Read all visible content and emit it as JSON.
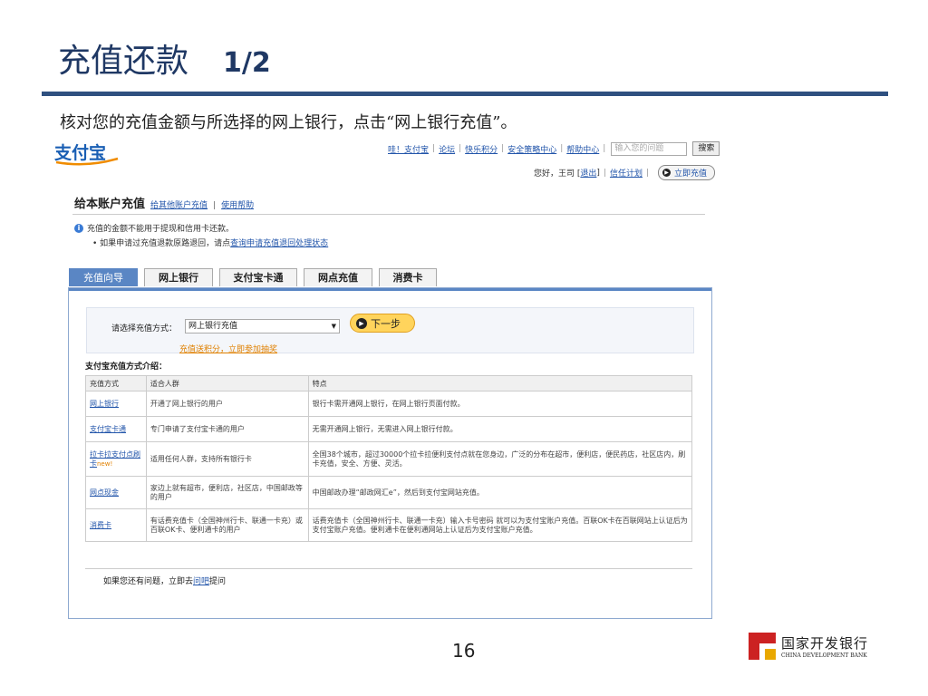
{
  "slide": {
    "title": "充值还款",
    "title_num": "1/2",
    "instruction": "核对您的充值金额与所选择的网上银行，点击“网上银行充值”。",
    "page_number": "16"
  },
  "alipay": {
    "logo_text": "支付宝",
    "top_links": [
      "哇！支付宝",
      "论坛",
      "快乐积分",
      "安全策略中心",
      "帮助中心"
    ],
    "search_placeholder": "输入您的问题",
    "search_button": "搜索",
    "greeting": "您好，王司 [",
    "logout": "退出",
    "greeting_end": "]",
    "trust_plan": "信任计划",
    "open_now": "立即充值"
  },
  "account": {
    "heading": "给本账户充值",
    "link_other": "给其他账户充值",
    "link_help": "使用帮助",
    "notice1": "充值的金额不能用于提现和信用卡还款。",
    "notice2_prefix": "• 如果申请过充值退款原路退回，请点",
    "notice2_link": "查询申请充值退回处理状态"
  },
  "tabs": [
    {
      "label": "充值向导",
      "active": true
    },
    {
      "label": "网上银行",
      "active": false
    },
    {
      "label": "支付宝卡通",
      "active": false
    },
    {
      "label": "网点充值",
      "active": false
    },
    {
      "label": "消费卡",
      "active": false
    }
  ],
  "form": {
    "select_label": "请选择充值方式：",
    "select_value": "网上银行充值",
    "next_button": "下一步",
    "promo_link": "充值送积分，立即参加抽奖"
  },
  "intro": {
    "title": "支付宝充值方式介绍：",
    "headers": [
      "充值方式",
      "适合人群",
      "特点"
    ],
    "rows": [
      {
        "method": "网上银行",
        "audience": "开通了网上银行的用户",
        "feature": "银行卡需开通网上银行，在网上银行页面付款。"
      },
      {
        "method": "支付宝卡通",
        "audience": "专门申请了支付宝卡通的用户",
        "feature": "无需开通网上银行，无需进入网上银行付款。"
      },
      {
        "method": "拉卡拉支付点刷卡",
        "badge": "new!",
        "audience": "适用任何人群，支持所有银行卡",
        "feature": "全国38个城市，超过30000个拉卡拉便利支付点就在您身边，广泛的分布在超市，便利店，便民药店，社区店内，刷卡充值，安全、方便、灵活。"
      },
      {
        "method": "网点现金",
        "audience": "家边上就有超市，便利店，社区店，中国邮政等的用户",
        "feature": "中国邮政办理“邮政网汇e”，然后到支付宝网站充值。"
      },
      {
        "method": "消费卡",
        "audience": "有话费充值卡（全国神州行卡、联通一卡充）或百联OK卡、便利通卡的用户",
        "feature": "话费充值卡（全国神州行卡、联通一卡充）输入卡号密码 就可以为支付宝账户充值。百联OK卡在百联网站上认证后为支付宝账户充值。便利通卡在便利通网站上认证后为支付宝账户充值。"
      }
    ],
    "help_prefix": "如果您还有问题，立即去",
    "help_link": "问吧",
    "help_suffix": "提问"
  },
  "bank": {
    "name_cn": "国家开发银行",
    "name_en": "CHINA DEVELOPMENT BANK"
  },
  "colors": {
    "title": "#1f3864",
    "rule": "#2f5080",
    "tab_active": "#5a86c4",
    "link": "#2255aa",
    "accent_orange": "#e08000",
    "brand_red": "#cc2222"
  }
}
